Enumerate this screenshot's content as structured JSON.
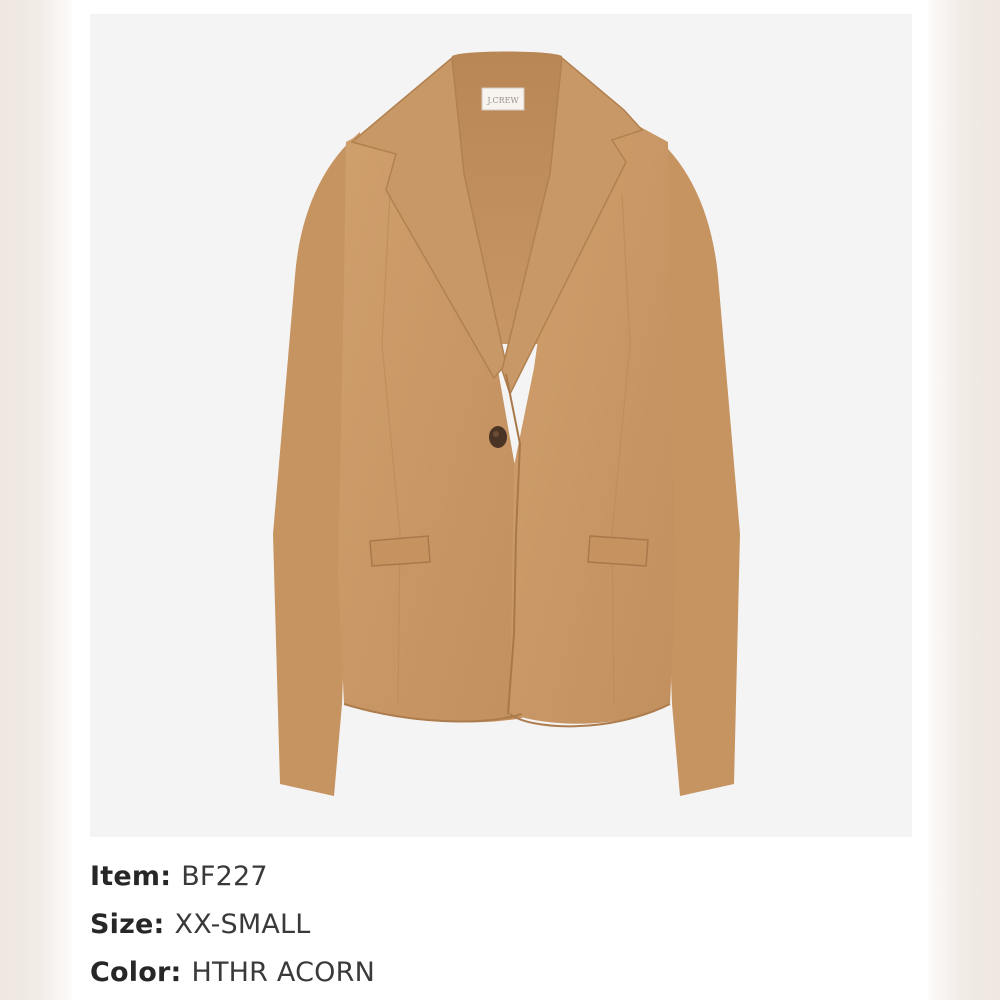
{
  "product": {
    "image_alt": "Camel one-button knit blazer",
    "label_text": "J.CREW",
    "colors": {
      "fabric": "#c99866",
      "fabric_shadow": "#b98655",
      "button": "#4a3426",
      "background": "#f5f4f5"
    }
  },
  "details": {
    "item": {
      "label": "Item:",
      "value": "BF227"
    },
    "size": {
      "label": "Size:",
      "value": "XX-SMALL"
    },
    "color": {
      "label": "Color:",
      "value": "HTHR ACORN"
    }
  }
}
